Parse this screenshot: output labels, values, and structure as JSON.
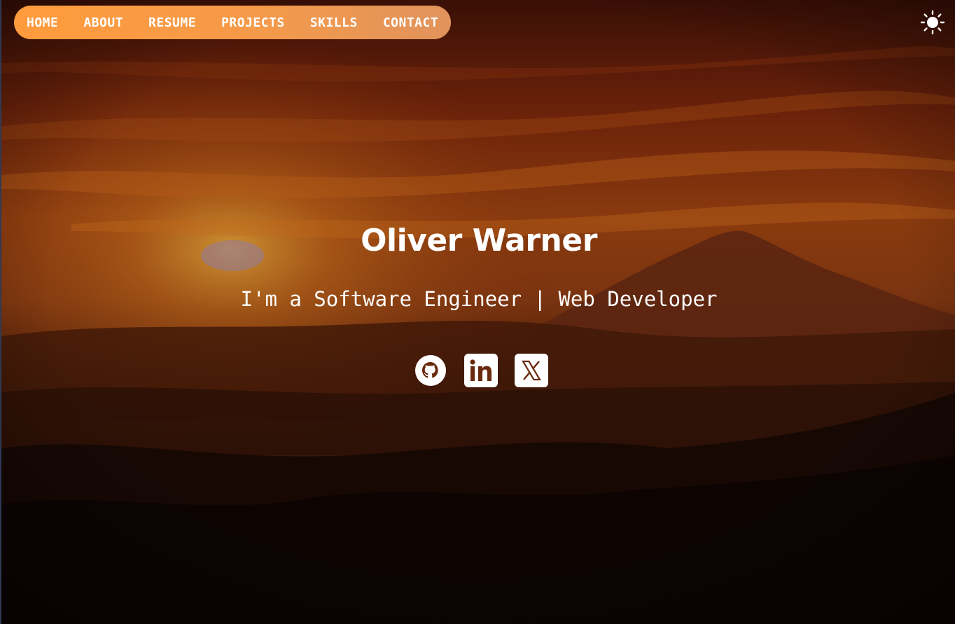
{
  "nav": {
    "items": [
      {
        "label": "HOME"
      },
      {
        "label": "ABOUT"
      },
      {
        "label": "RESUME"
      },
      {
        "label": "PROJECTS"
      },
      {
        "label": "SKILLS"
      },
      {
        "label": "CONTACT"
      }
    ],
    "gradient_start": "#ff9b3c",
    "gradient_end": "#e0935c"
  },
  "theme_toggle": {
    "icon": "sun-icon"
  },
  "hero": {
    "name": "Oliver Warner",
    "tagline": "I'm a Software Engineer | Web Developer",
    "background": "sunset-mountain-photo"
  },
  "socials": [
    {
      "icon": "github-icon"
    },
    {
      "icon": "linkedin-icon"
    },
    {
      "icon": "x-twitter-icon"
    }
  ]
}
